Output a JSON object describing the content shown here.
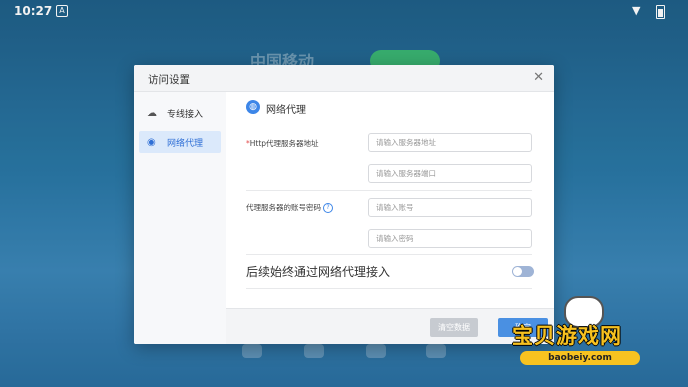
{
  "status_bar": {
    "time": "10:27",
    "app_icon": "A"
  },
  "background": {
    "brand_text": "中国移动"
  },
  "dialog": {
    "title": "访问设置",
    "close_glyph": "✕",
    "sidebar": [
      {
        "label": "专线接入",
        "icon": "cloud-icon",
        "active": false
      },
      {
        "label": "网络代理",
        "icon": "globe-icon",
        "active": true
      }
    ],
    "section_title": "网络代理",
    "proxy_address": {
      "required_mark": "*",
      "label": "Http代理服务器地址",
      "address_placeholder": "请输入服务器地址",
      "port_placeholder": "请输入服务器端口"
    },
    "proxy_account": {
      "label": "代理服务器的账号密码",
      "help_glyph": "?",
      "account_placeholder": "请输入账号",
      "password_placeholder": "请输入密码"
    },
    "toggle_label": "后续始终通过网络代理接入",
    "toggle_on": false,
    "buttons": {
      "clear": "清空数据",
      "ok": "确定"
    }
  },
  "watermark": {
    "text": "宝贝游戏网",
    "url": "baobeiy.com"
  },
  "colors": {
    "accent": "#4a90e2",
    "active_bg": "#dbe9fb",
    "required": "#e24b4b"
  }
}
